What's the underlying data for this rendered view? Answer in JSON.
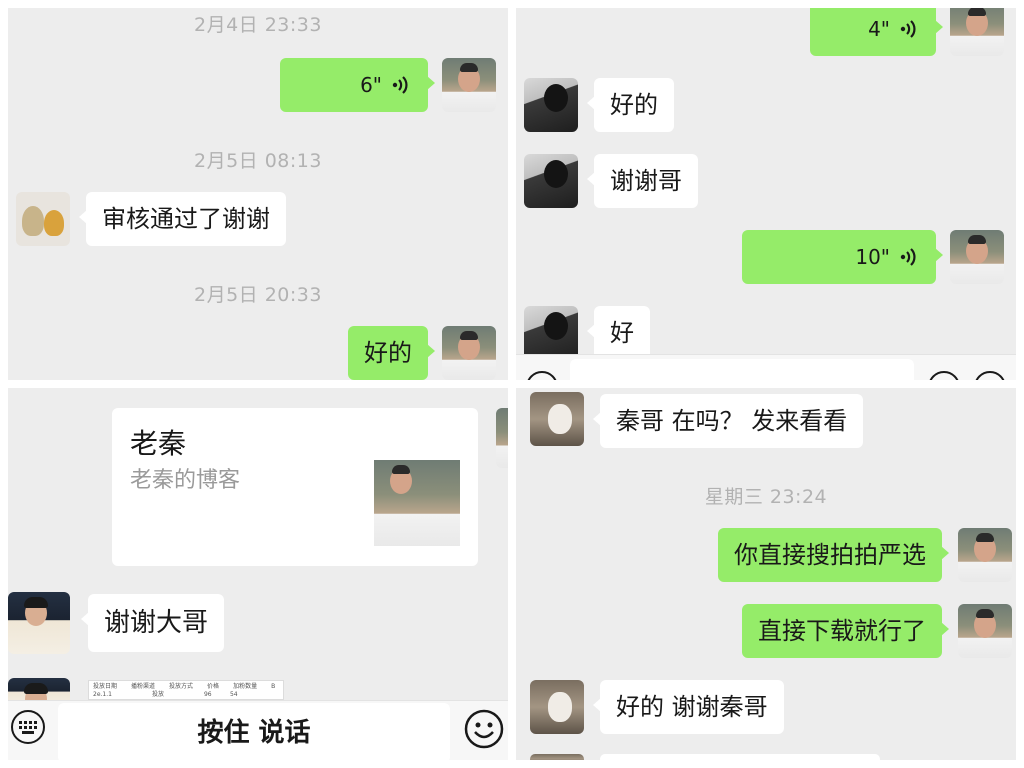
{
  "panel1": {
    "ts1": "2月4日 23:33",
    "voice1": "6\"",
    "ts2": "2月5日 08:13",
    "msg_in": "审核通过了谢谢",
    "ts3": "2月5日 20:33",
    "msg_out": "好的"
  },
  "panel2": {
    "voice1": "4\"",
    "msg_in1": "好的",
    "msg_in2": "谢谢哥",
    "voice2": "10\"",
    "msg_in3": "好"
  },
  "panel3": {
    "card_title": "老秦",
    "card_sub": "老秦的博客",
    "msg_in": "谢谢大哥",
    "doc_headers": [
      "投放日期",
      "播粉渠道",
      "投放方式",
      "价格",
      "加粉数量",
      "B"
    ],
    "doc_row": [
      "2e.1.1",
      "",
      "投放",
      "",
      "96",
      "54"
    ],
    "talk_label": "按住 说话",
    "keyboard_icon": "keyboard-icon",
    "emoji_icon": "emoji-icon"
  },
  "panel4": {
    "msg_in1": "秦哥 在吗？ 发来看看",
    "ts1": "星期三 23:24",
    "msg_out1": "你直接搜拍拍严选",
    "msg_out2": "直接下载就行了",
    "msg_in2": "好的 谢谢秦哥"
  },
  "colors": {
    "panel_bg": "#ededed",
    "bubble_out": "#95ec69",
    "bubble_in": "#ffffff",
    "timestamp": "#b2b2b2"
  }
}
